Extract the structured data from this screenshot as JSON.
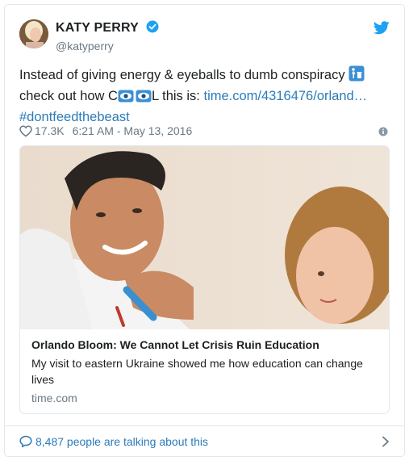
{
  "author": {
    "display_name": "KATY PERRY",
    "handle": "@katyperry",
    "verified": true
  },
  "tweet": {
    "text_part1": "Instead of giving energy & eyeballs to  dumb conspiracy",
    "text_part2": " check out how C",
    "text_part3": "L this is: ",
    "link": "time.com/4316476/orland…",
    "hashtag": "#dontfeedthebeast",
    "likes": "17.3K",
    "timestamp": "6:21 AM - May 13, 2016"
  },
  "card": {
    "title": "Orlando Bloom: We Cannot Let Crisis Ruin Education",
    "description": "My visit to eastern Ukraine showed me how education can change lives",
    "domain": "time.com"
  },
  "footer": {
    "talking": "8,487 people are talking about this"
  },
  "icons": {
    "brand": "twitter-bird-icon",
    "verified": "verified-badge-icon",
    "like": "heart-icon",
    "info": "info-icon",
    "reply": "speech-bubble-icon",
    "chevron": "chevron-right-icon"
  },
  "colors": {
    "twitter_blue": "#1da1f2",
    "link": "#2b7bb9",
    "secondary_text": "#697882",
    "border": "#e1e8ed"
  }
}
